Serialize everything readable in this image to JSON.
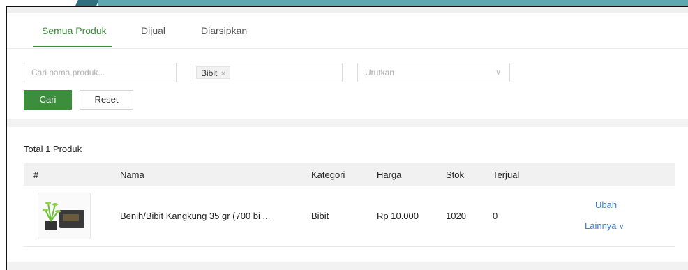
{
  "tabs": [
    {
      "label": "Semua Produk",
      "active": true
    },
    {
      "label": "Dijual",
      "active": false
    },
    {
      "label": "Diarsipkan",
      "active": false
    }
  ],
  "filters": {
    "search_placeholder": "Cari nama produk...",
    "category_tag": "Bibit",
    "tag_remove": "×",
    "sort_placeholder": "Urutkan",
    "search_button": "Cari",
    "reset_button": "Reset"
  },
  "summary": {
    "total_text": "Total 1 Produk"
  },
  "table": {
    "headers": [
      "#",
      "Nama",
      "Kategori",
      "Harga",
      "Stok",
      "Terjual"
    ],
    "rows": [
      {
        "name": "Benih/Bibit Kangkung 35 gr (700 bi ...",
        "category": "Bibit",
        "price": "Rp 10.000",
        "stock": "1020",
        "sold": "0",
        "action_edit": "Ubah",
        "action_more": "Lainnya",
        "more_chevron": "∨"
      }
    ]
  },
  "colors": {
    "accent": "#3c8d3c",
    "link": "#3a7fd5",
    "header_bg": "#f1f1f1"
  }
}
